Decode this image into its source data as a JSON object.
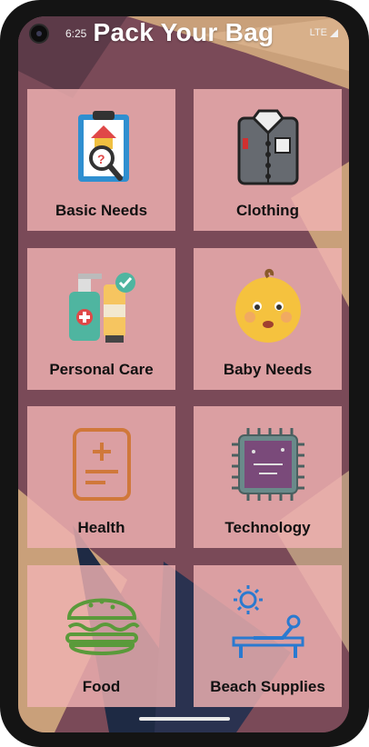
{
  "status_bar": {
    "time": "6:25",
    "network": "LTE"
  },
  "header": {
    "title": "Pack Your Bag"
  },
  "categories": [
    {
      "label": "Basic Needs",
      "icon": "clipboard-search-icon"
    },
    {
      "label": "Clothing",
      "icon": "shirt-icon"
    },
    {
      "label": "Personal Care",
      "icon": "toiletries-icon"
    },
    {
      "label": "Baby Needs",
      "icon": "baby-face-icon"
    },
    {
      "label": "Health",
      "icon": "medical-document-icon"
    },
    {
      "label": "Technology",
      "icon": "microchip-icon"
    },
    {
      "label": "Food",
      "icon": "burger-icon"
    },
    {
      "label": "Beach Supplies",
      "icon": "sunbed-icon"
    }
  ],
  "colors": {
    "tile": "#f0b2b2",
    "background": "#7a4a58",
    "text": "#111111"
  }
}
